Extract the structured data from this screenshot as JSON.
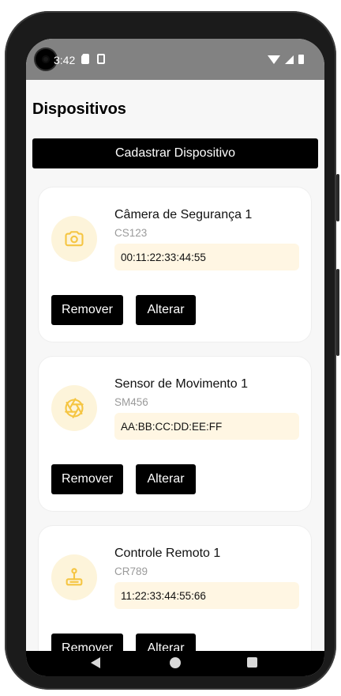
{
  "status_bar": {
    "time": "3:42"
  },
  "page": {
    "title": "Dispositivos",
    "register_button": "Cadastrar Dispositivo"
  },
  "devices": [
    {
      "name": "Câmera de Segurança 1",
      "code": "CS123",
      "mac": "00:11:22:33:44:55",
      "icon": "camera-icon",
      "remove_label": "Remover",
      "edit_label": "Alterar"
    },
    {
      "name": "Sensor de Movimento 1",
      "code": "SM456",
      "mac": "AA:BB:CC:DD:EE:FF",
      "icon": "aperture-icon",
      "remove_label": "Remover",
      "edit_label": "Alterar"
    },
    {
      "name": "Controle Remoto 1",
      "code": "CR789",
      "mac": "11:22:33:44:55:66",
      "icon": "joystick-icon",
      "remove_label": "Remover",
      "edit_label": "Alterar"
    }
  ],
  "colors": {
    "accent": "#f5c542",
    "icon_bg": "#fdf4da",
    "mac_bg": "#fff6e3",
    "button": "#000000"
  }
}
